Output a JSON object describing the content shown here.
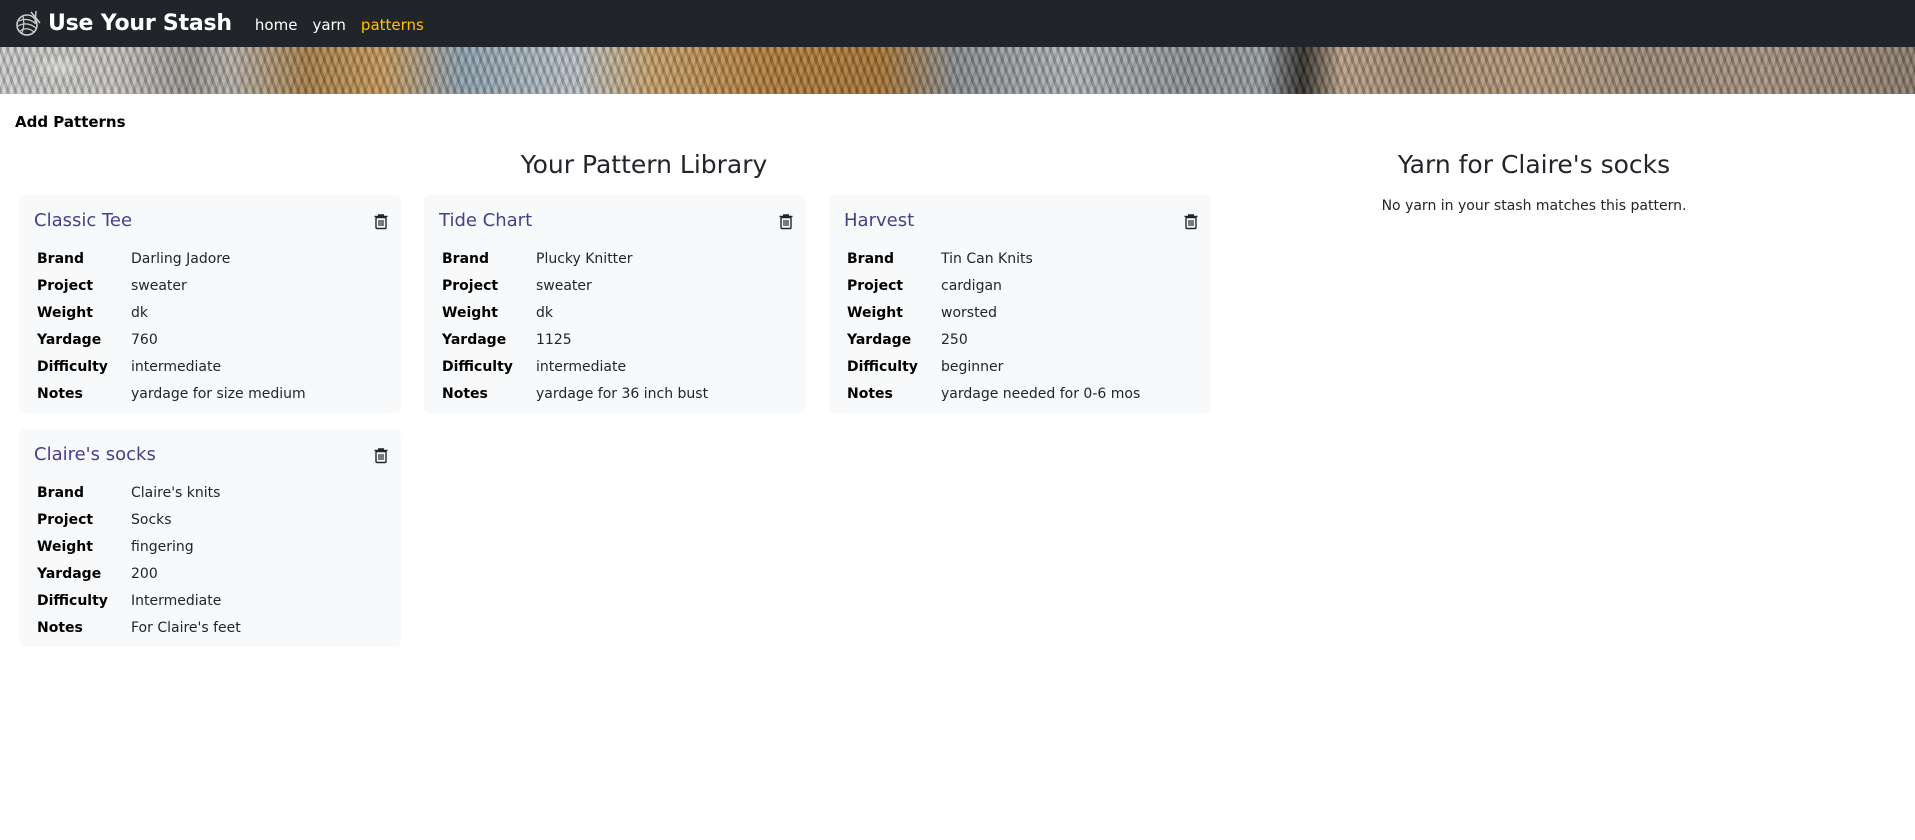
{
  "navbar": {
    "brand": "Use Your Stash",
    "logo_icon": "yarn-ball-icon",
    "links": [
      {
        "label": "home",
        "active": false
      },
      {
        "label": "yarn",
        "active": false
      },
      {
        "label": "patterns",
        "active": true
      }
    ],
    "active_color": "#ffc107"
  },
  "add_heading": "Add Patterns",
  "library": {
    "title": "Your Pattern Library",
    "field_labels": [
      "Brand",
      "Project",
      "Weight",
      "Yardage",
      "Difficulty",
      "Notes"
    ],
    "patterns": [
      {
        "name": "Classic Tee",
        "brand": "Darling Jadore",
        "project": "sweater",
        "weight": "dk",
        "yardage": "760",
        "difficulty": "intermediate",
        "notes": "yardage for size medium"
      },
      {
        "name": "Tide Chart",
        "brand": "Plucky Knitter",
        "project": "sweater",
        "weight": "dk",
        "yardage": "1125",
        "difficulty": "intermediate",
        "notes": "yardage for 36 inch bust"
      },
      {
        "name": "Harvest",
        "brand": "Tin Can Knits",
        "project": "cardigan",
        "weight": "worsted",
        "yardage": "250",
        "difficulty": "beginner",
        "notes": "yardage needed for 0-6 mos"
      },
      {
        "name": "Claire's socks",
        "brand": "Claire's knits",
        "project": "Socks",
        "weight": "fingering",
        "yardage": "200",
        "difficulty": "Intermediate",
        "notes": "For Claire's feet"
      }
    ],
    "delete_icon": "trash-icon"
  },
  "yarn_panel": {
    "title": "Yarn for Claire's socks",
    "empty_message": "No yarn in your stash matches this pattern."
  },
  "colors": {
    "navbar_bg": "#212529",
    "card_bg": "#f8f9fa",
    "pattern_title": "#483d8b"
  }
}
